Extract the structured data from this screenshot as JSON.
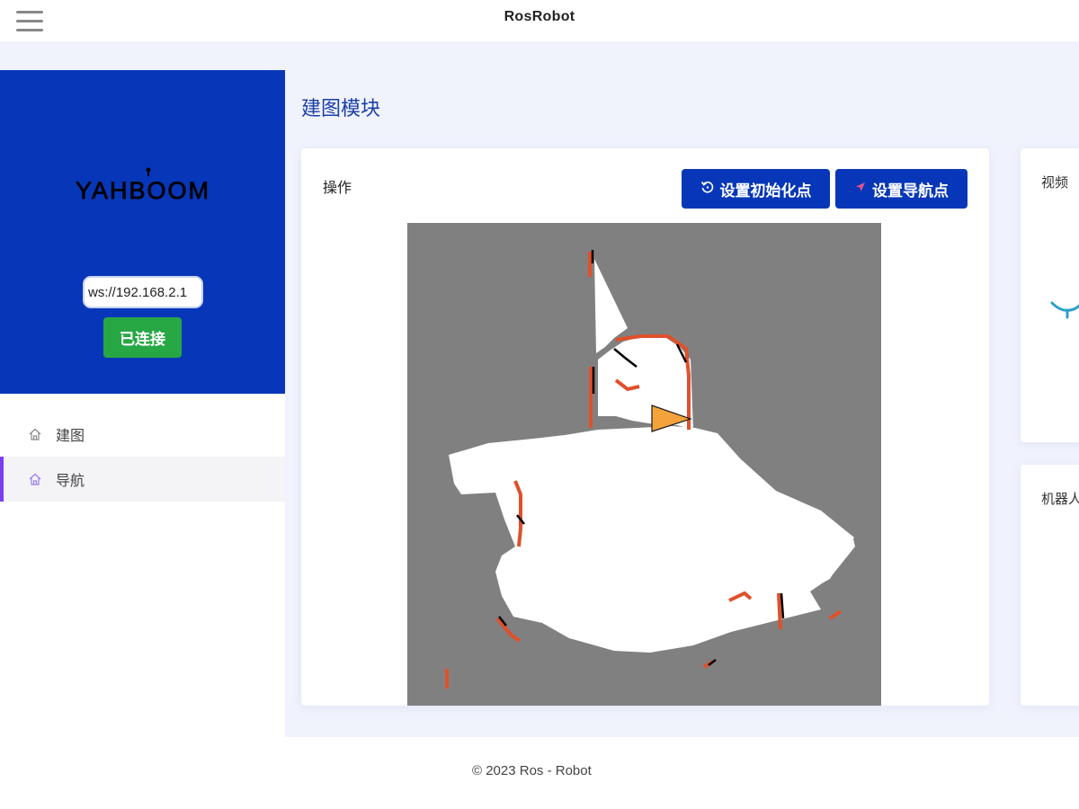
{
  "app": {
    "title": "RosRobot"
  },
  "sidebar": {
    "logo_text": "YAHBOOM",
    "ws_url": "ws://192.168.2.1",
    "connect_status": "已连接",
    "items": [
      {
        "label": "建图",
        "icon": "home-icon",
        "active": false
      },
      {
        "label": "导航",
        "icon": "home-icon",
        "active": true
      }
    ]
  },
  "main": {
    "title": "建图模块",
    "operation": {
      "label": "操作",
      "set_init_point": "设置初始化点",
      "set_nav_point": "设置导航点"
    },
    "video": {
      "label": "视频"
    },
    "robot": {
      "label": "机器人"
    }
  },
  "footer": {
    "copyright": "© 2023 Ros - Robot"
  },
  "colors": {
    "brand_blue": "#0737b8",
    "success_green": "#28a745",
    "active_indicator": "#7b3ff2",
    "map_unknown": "#808080",
    "map_obstacle": "#e0502a",
    "robot_marker": "#f4a23c"
  }
}
